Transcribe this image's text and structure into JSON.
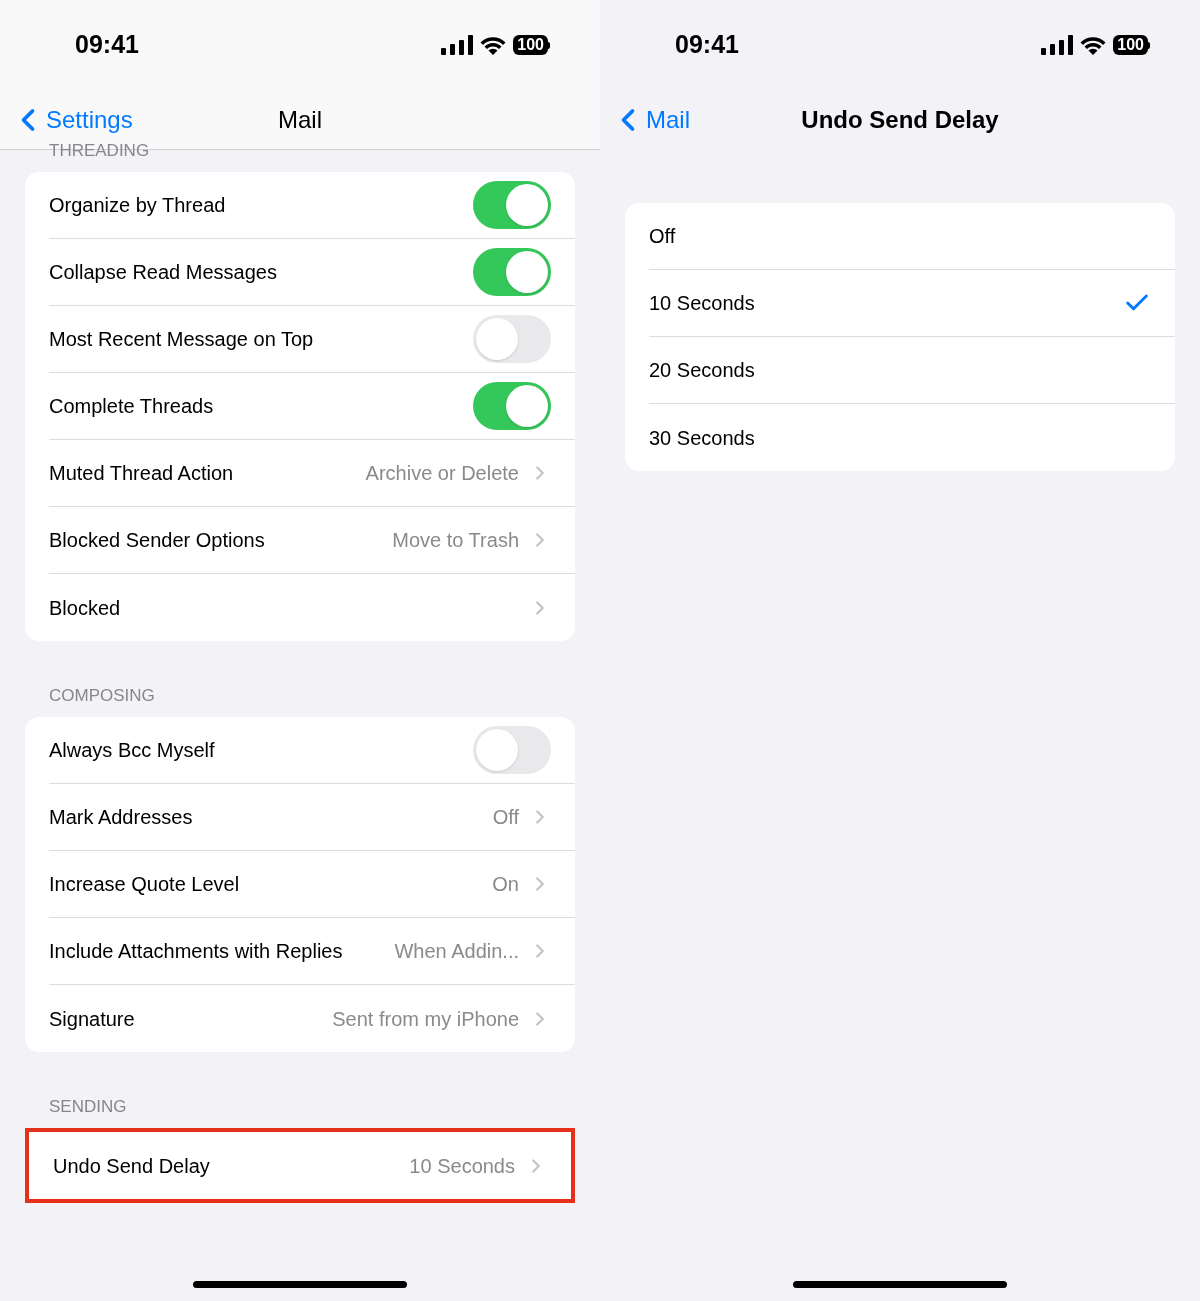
{
  "screens": [
    {
      "status_bar": {
        "time": "09:41",
        "battery": "100"
      },
      "nav": {
        "back": "Settings",
        "title": "Mail",
        "title_bold": false
      },
      "header_bg": true,
      "sections": [
        {
          "header": "THREADING",
          "rows": [
            {
              "kind": "toggle",
              "label": "Organize by Thread",
              "on": true
            },
            {
              "kind": "toggle",
              "label": "Collapse Read Messages",
              "on": true
            },
            {
              "kind": "toggle",
              "label": "Most Recent Message on Top",
              "on": false
            },
            {
              "kind": "toggle",
              "label": "Complete Threads",
              "on": true
            },
            {
              "kind": "link",
              "label": "Muted Thread Action",
              "value": "Archive or Delete"
            },
            {
              "kind": "link",
              "label": "Blocked Sender Options",
              "value": "Move to Trash"
            },
            {
              "kind": "link",
              "label": "Blocked"
            }
          ]
        },
        {
          "header": "COMPOSING",
          "rows": [
            {
              "kind": "toggle",
              "label": "Always Bcc Myself",
              "on": false
            },
            {
              "kind": "link",
              "label": "Mark Addresses",
              "value": "Off"
            },
            {
              "kind": "link",
              "label": "Increase Quote Level",
              "value": "On"
            },
            {
              "kind": "link",
              "label": "Include Attachments with Replies",
              "value": "When Addin..."
            },
            {
              "kind": "link",
              "label": "Signature",
              "value": "Sent from my iPhone"
            }
          ]
        },
        {
          "header": "SENDING",
          "highlighted": true,
          "rows": [
            {
              "kind": "link",
              "label": "Undo Send Delay",
              "value": "10 Seconds"
            }
          ]
        }
      ]
    },
    {
      "status_bar": {
        "time": "09:41",
        "battery": "100"
      },
      "nav": {
        "back": "Mail",
        "title": "Undo Send Delay",
        "title_bold": true
      },
      "header_bg": false,
      "sections": [
        {
          "highlighted": false,
          "rows": [
            {
              "kind": "choice",
              "label": "Off",
              "selected": false
            },
            {
              "kind": "choice",
              "label": "10 Seconds",
              "selected": true
            },
            {
              "kind": "choice",
              "label": "20 Seconds",
              "selected": false
            },
            {
              "kind": "choice",
              "label": "30 Seconds",
              "selected": false
            }
          ]
        }
      ]
    }
  ]
}
